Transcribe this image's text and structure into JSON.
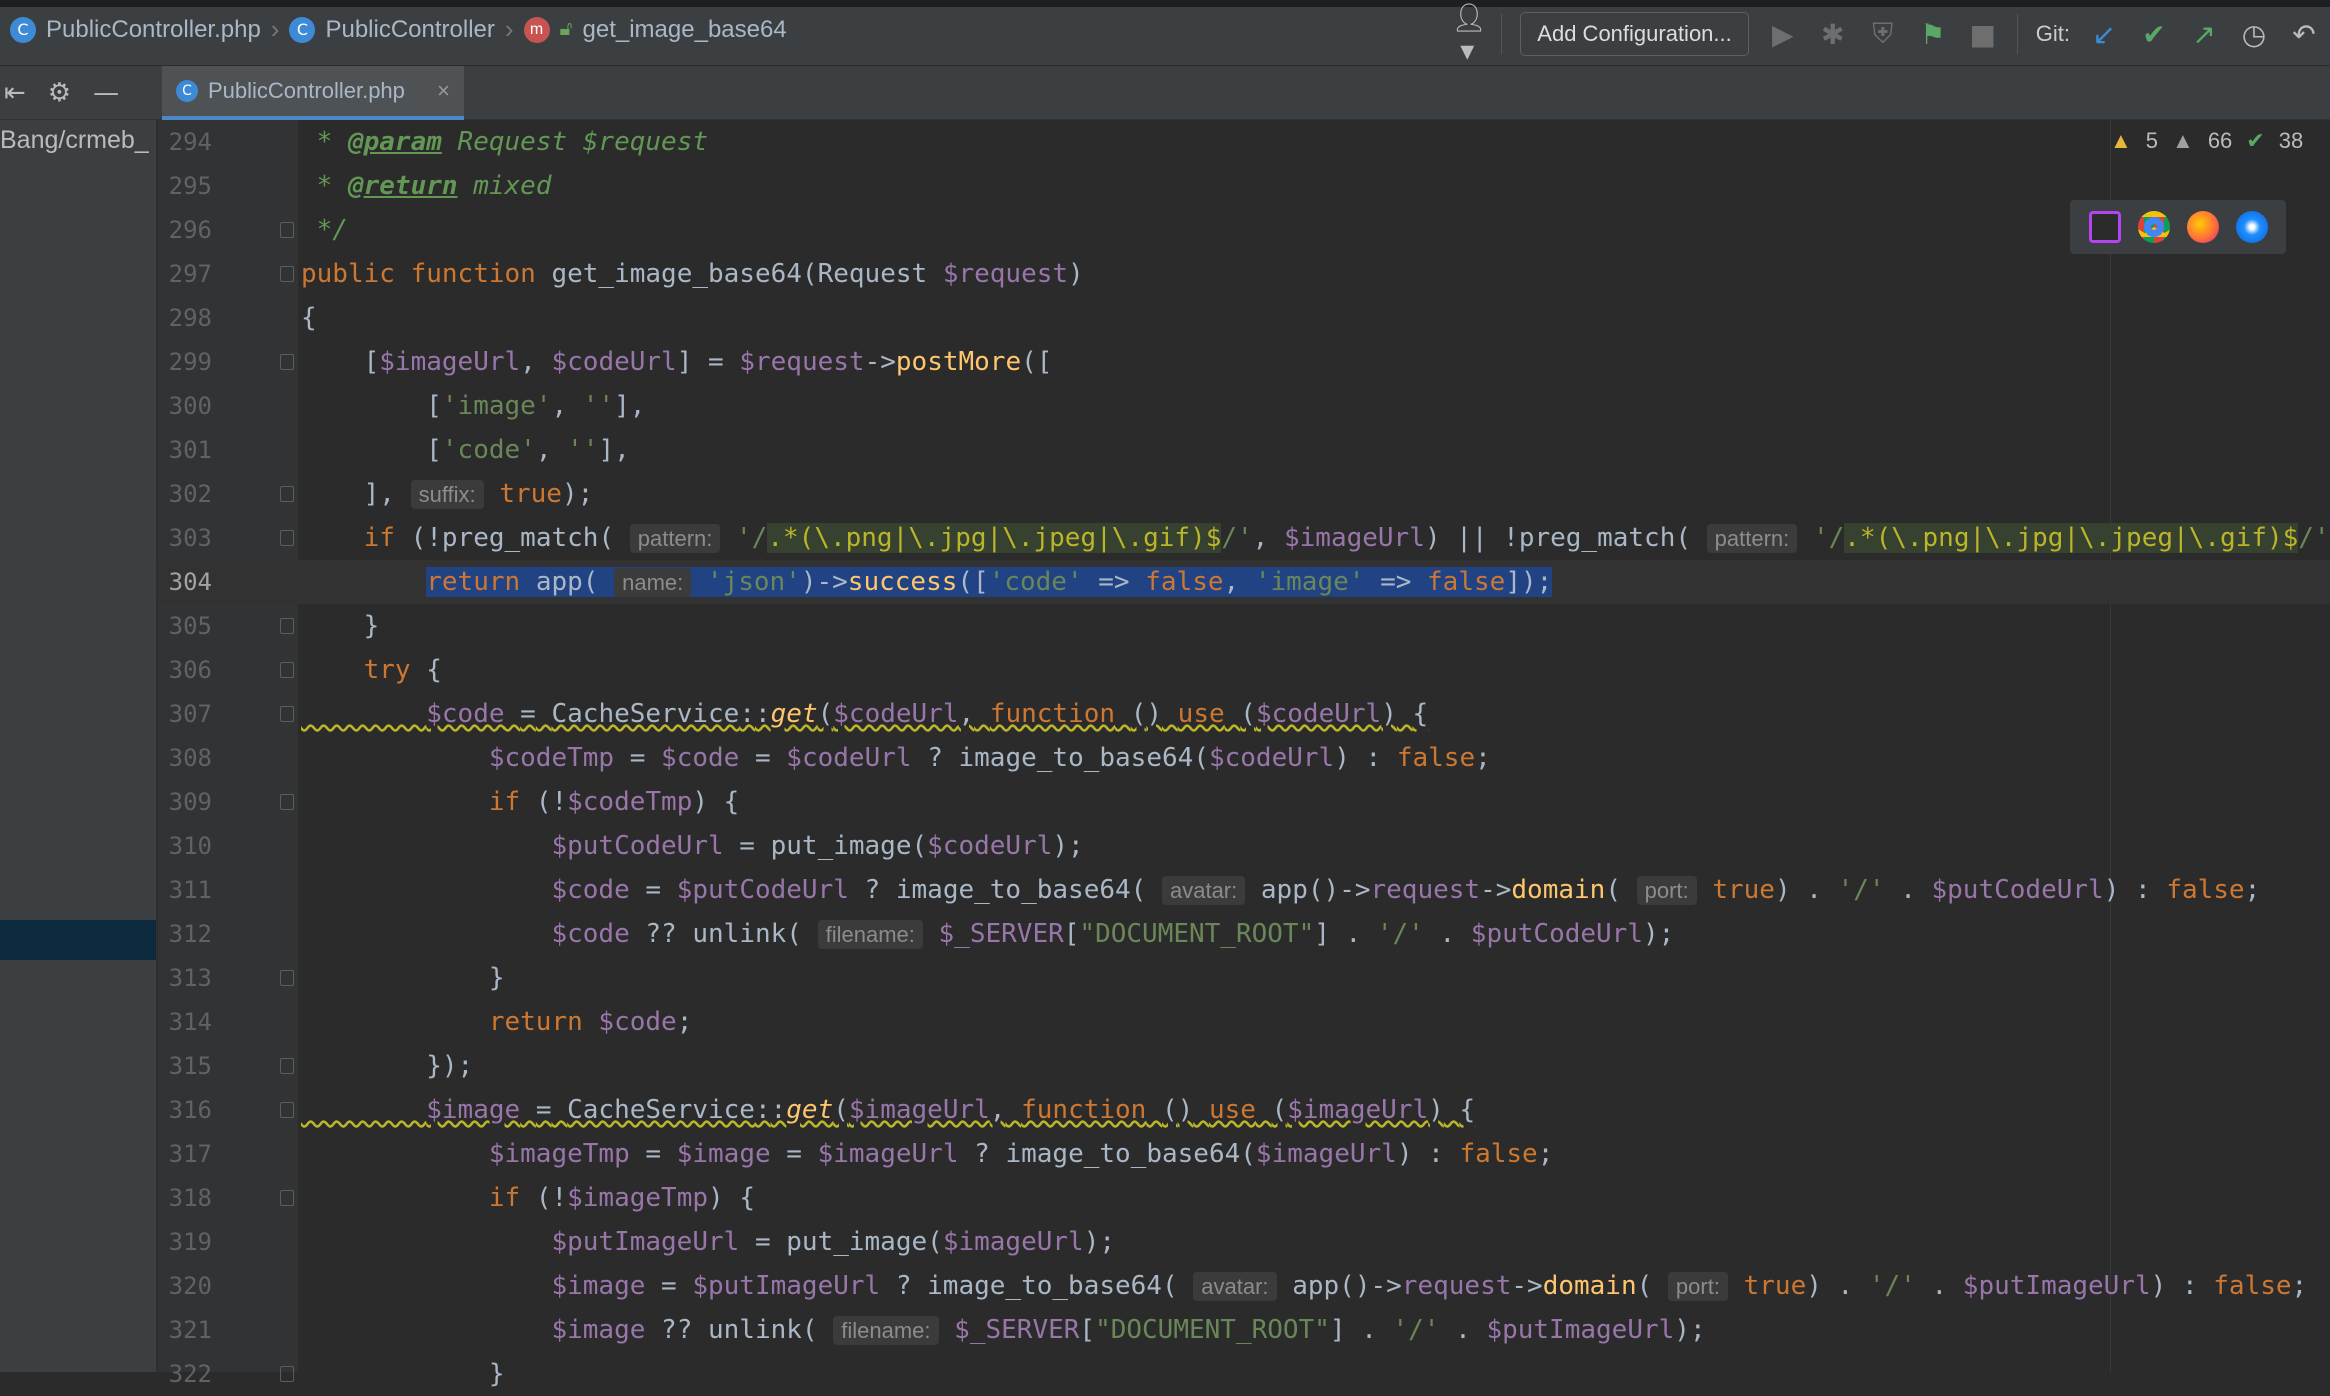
{
  "breadcrumbs": {
    "file": "PublicController.php",
    "class": "PublicController",
    "method": "get_image_base64"
  },
  "toolbar": {
    "config_label": "Add Configuration...",
    "git_label": "Git:"
  },
  "tab": {
    "label": "PublicController.php"
  },
  "sidebar": {
    "path_text": "Bang/crmeb_"
  },
  "inspections": {
    "warnings": "5",
    "weak_warnings": "66",
    "ok": "38"
  },
  "colors": {
    "accent": "#4a88c7",
    "selection": "#214283",
    "background": "#2b2b2b"
  },
  "code_lines": [
    {
      "n": "294",
      "text": " * @param Request $request"
    },
    {
      "n": "295",
      "text": " * @return mixed"
    },
    {
      "n": "296",
      "text": " */"
    },
    {
      "n": "297",
      "text": "public function get_image_base64(Request $request)"
    },
    {
      "n": "298",
      "text": "{"
    },
    {
      "n": "299",
      "text": "    [$imageUrl, $codeUrl] = $request->postMore(["
    },
    {
      "n": "300",
      "text": "        ['image', ''],"
    },
    {
      "n": "301",
      "text": "        ['code', ''],"
    },
    {
      "n": "302",
      "text": "    ], suffix: true);"
    },
    {
      "n": "303",
      "text": "    if (!preg_match( pattern: '/.*(\\.png|\\.jpg|\\.jpeg|\\.gif)$/', $imageUrl) || !preg_match( pattern: '/.*(\\.png|\\.jpg|\\.jpeg|\\.gif)$/',"
    },
    {
      "n": "304",
      "text": "        return app( name: 'json')->success(['code' => false, 'image' => false]);"
    },
    {
      "n": "305",
      "text": "    }"
    },
    {
      "n": "306",
      "text": "    try {"
    },
    {
      "n": "307",
      "text": "        $code = CacheService::get($codeUrl, function () use ($codeUrl) {"
    },
    {
      "n": "308",
      "text": "            $codeTmp = $code = $codeUrl ? image_to_base64($codeUrl) : false;"
    },
    {
      "n": "309",
      "text": "            if (!$codeTmp) {"
    },
    {
      "n": "310",
      "text": "                $putCodeUrl = put_image($codeUrl);"
    },
    {
      "n": "311",
      "text": "                $code = $putCodeUrl ? image_to_base64( avatar: app()->request->domain( port: true) . '/' . $putCodeUrl) : false;"
    },
    {
      "n": "312",
      "text": "                $code ?? unlink( filename: $_SERVER[\"DOCUMENT_ROOT\"] . '/' . $putCodeUrl);"
    },
    {
      "n": "313",
      "text": "            }"
    },
    {
      "n": "314",
      "text": "            return $code;"
    },
    {
      "n": "315",
      "text": "        });"
    },
    {
      "n": "316",
      "text": "        $image = CacheService::get($imageUrl, function () use ($imageUrl) {"
    },
    {
      "n": "317",
      "text": "            $imageTmp = $image = $imageUrl ? image_to_base64($imageUrl) : false;"
    },
    {
      "n": "318",
      "text": "            if (!$imageTmp) {"
    },
    {
      "n": "319",
      "text": "                $putImageUrl = put_image($imageUrl);"
    },
    {
      "n": "320",
      "text": "                $image = $putImageUrl ? image_to_base64( avatar: app()->request->domain( port: true) . '/' . $putImageUrl) : false;"
    },
    {
      "n": "321",
      "text": "                $image ?? unlink( filename: $_SERVER[\"DOCUMENT_ROOT\"] . '/' . $putImageUrl);"
    },
    {
      "n": "322",
      "text": "            }"
    }
  ]
}
